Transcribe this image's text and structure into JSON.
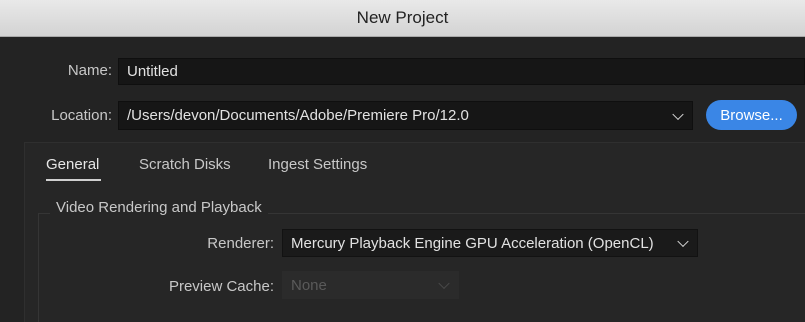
{
  "window": {
    "title": "New Project"
  },
  "name": {
    "label": "Name:",
    "value": "Untitled"
  },
  "location": {
    "label": "Location:",
    "value": "/Users/devon/Documents/Adobe/Premiere Pro/12.0"
  },
  "browse": {
    "label": "Browse..."
  },
  "tabs": [
    {
      "label": "General",
      "active": true
    },
    {
      "label": "Scratch Disks",
      "active": false
    },
    {
      "label": "Ingest Settings",
      "active": false
    }
  ],
  "video_rendering": {
    "title": "Video Rendering and Playback",
    "renderer": {
      "label": "Renderer:",
      "value": "Mercury Playback Engine GPU Acceleration (OpenCL)"
    },
    "preview_cache": {
      "label": "Preview Cache:",
      "value": "None",
      "disabled": true
    }
  },
  "colors": {
    "accent": "#3a86e6",
    "background": "#232323"
  },
  "icons": {
    "dropdown": "chevron-down-icon"
  }
}
